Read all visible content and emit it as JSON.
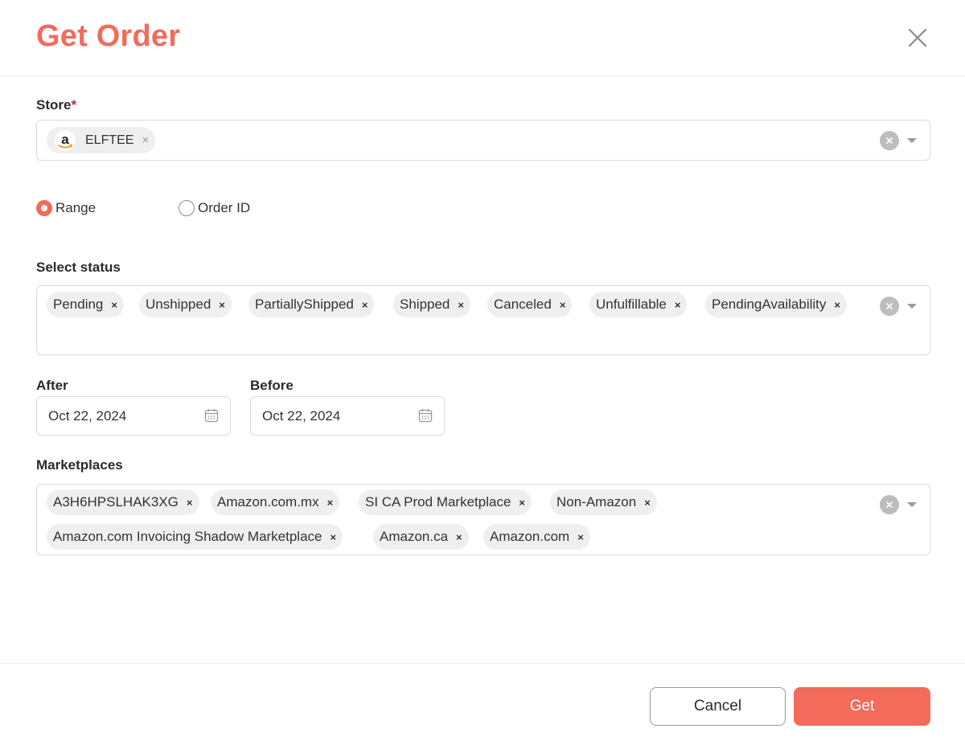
{
  "dialog": {
    "title": "Get Order"
  },
  "store": {
    "label": "Store",
    "required_mark": "*",
    "selected": [
      {
        "name": "ELFTEE",
        "icon": "amazon-logo-icon"
      }
    ]
  },
  "mode": {
    "options": [
      {
        "label": "Range",
        "selected": true
      },
      {
        "label": "Order ID",
        "selected": false
      }
    ]
  },
  "status": {
    "label": "Select status",
    "chips": [
      "Pending",
      "Unshipped",
      "PartiallyShipped",
      "Shipped",
      "Canceled",
      "Unfulfillable",
      "PendingAvailability"
    ]
  },
  "dates": {
    "after": {
      "label": "After",
      "value": "Oct 22, 2024"
    },
    "before": {
      "label": "Before",
      "value": "Oct 22, 2024"
    }
  },
  "marketplaces": {
    "label": "Marketplaces",
    "chips": [
      "A3H6HPSLHAK3XG",
      "Amazon.com.mx",
      "SI CA Prod Marketplace",
      "Non-Amazon",
      "Amazon.com Invoicing Shadow Marketplace",
      "Amazon.ca",
      "Amazon.com"
    ]
  },
  "chip_remove_glyph": "×",
  "footer": {
    "cancel_label": "Cancel",
    "get_label": "Get"
  },
  "colors": {
    "accent": "#f26b5b",
    "required": "#d0202e"
  }
}
